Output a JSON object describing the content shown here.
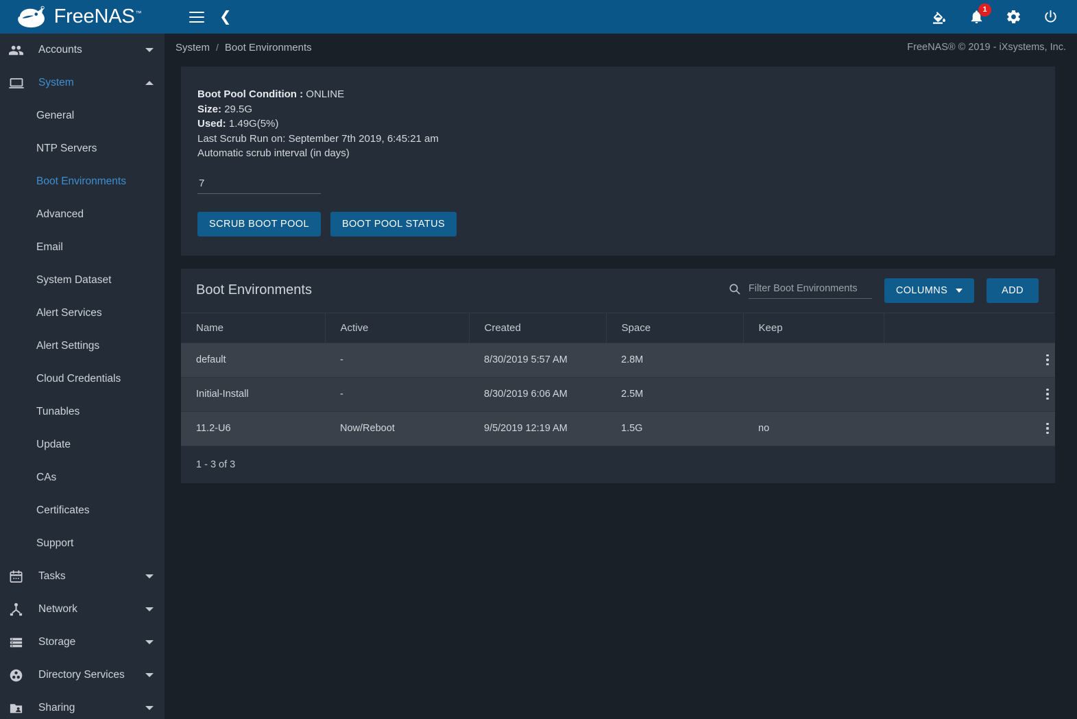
{
  "app": {
    "brand": "FreeNAS",
    "brand_tm": "™",
    "copyright": "FreeNAS® © 2019 - iXsystems, Inc."
  },
  "topbar": {
    "menu_icon": "hamburger-icon",
    "back_icon": "chevron-left-icon",
    "icons": [
      {
        "name": "theme-fill-icon",
        "glyph": "fill"
      },
      {
        "name": "notifications-bell-icon",
        "glyph": "bell",
        "badge": "1"
      },
      {
        "name": "settings-gear-icon",
        "glyph": "gear"
      },
      {
        "name": "power-icon",
        "glyph": "power"
      }
    ]
  },
  "breadcrumb": {
    "items": [
      "System",
      "Boot Environments"
    ],
    "separator": "/"
  },
  "sidebar": {
    "groups": [
      {
        "label": "Accounts",
        "icon": "accounts-people-icon",
        "expanded": false,
        "active": false
      },
      {
        "label": "System",
        "icon": "system-monitor-icon",
        "expanded": true,
        "active": true
      }
    ],
    "system_items": [
      {
        "label": "General",
        "active": false
      },
      {
        "label": "NTP Servers",
        "active": false
      },
      {
        "label": "Boot Environments",
        "active": true
      },
      {
        "label": "Advanced",
        "active": false
      },
      {
        "label": "Email",
        "active": false
      },
      {
        "label": "System Dataset",
        "active": false
      },
      {
        "label": "Alert Services",
        "active": false
      },
      {
        "label": "Alert Settings",
        "active": false
      },
      {
        "label": "Cloud Credentials",
        "active": false
      },
      {
        "label": "Tunables",
        "active": false
      },
      {
        "label": "Update",
        "active": false
      },
      {
        "label": "CAs",
        "active": false
      },
      {
        "label": "Certificates",
        "active": false
      },
      {
        "label": "Support",
        "active": false
      }
    ],
    "bottom_groups": [
      {
        "label": "Tasks",
        "icon": "calendar-icon"
      },
      {
        "label": "Network",
        "icon": "network-node-icon"
      },
      {
        "label": "Storage",
        "icon": "storage-list-icon"
      },
      {
        "label": "Directory Services",
        "icon": "directory-services-icon"
      },
      {
        "label": "Sharing",
        "icon": "sharing-folder-icon"
      }
    ]
  },
  "status_card": {
    "condition_label": "Boot Pool Condition :",
    "condition_value": "ONLINE",
    "size_label": "Size:",
    "size_value": "29.5G",
    "used_label": "Used:",
    "used_value": "1.49G(5%)",
    "last_scrub": "Last Scrub Run on: September 7th 2019, 6:45:21 am",
    "interval_label": "Automatic scrub interval (in days)",
    "interval_value": "7",
    "scrub_button": "SCRUB BOOT POOL",
    "status_button": "BOOT POOL STATUS"
  },
  "table_card": {
    "title": "Boot Environments",
    "search_placeholder": "Filter Boot Environments",
    "search_value": "",
    "columns_button": "COLUMNS",
    "add_button": "ADD",
    "headers": [
      "Name",
      "Active",
      "Created",
      "Space",
      "Keep",
      ""
    ],
    "rows": [
      {
        "name": "default",
        "active": "-",
        "created": "8/30/2019 5:57 AM",
        "space": "2.8M",
        "keep": ""
      },
      {
        "name": "Initial-Install",
        "active": "-",
        "created": "8/30/2019 6:06 AM",
        "space": "2.5M",
        "keep": ""
      },
      {
        "name": "11.2-U6",
        "active": "Now/Reboot",
        "created": "9/5/2019 12:19 AM",
        "space": "1.5G",
        "keep": "no"
      }
    ],
    "footer": "1 - 3 of 3"
  },
  "colors": {
    "header_blue": "#0b5689",
    "button_blue": "#0f5c8d",
    "accent_link": "#3d8fd1",
    "page_bg": "#1a2027",
    "card_bg": "#252d38",
    "sidebar_bg": "#242c37",
    "badge_red": "#e02020"
  }
}
